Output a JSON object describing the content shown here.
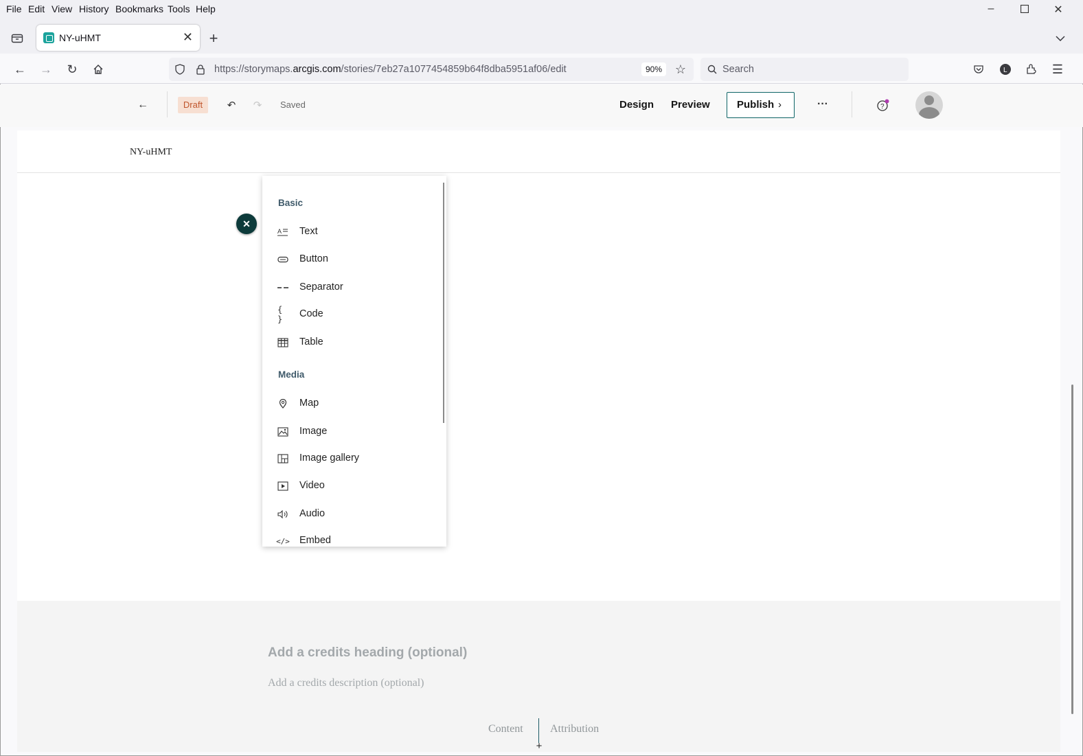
{
  "browser": {
    "menu": [
      "File",
      "Edit",
      "View",
      "History",
      "Bookmarks",
      "Tools",
      "Help"
    ],
    "tab_title": "NY-uHMT",
    "url_prefix": "https://storymaps.",
    "url_domain": "arcgis.com",
    "url_path": "/stories/7eb27a1077454859b64f8dba5951af06/edit",
    "zoom": "90%",
    "search_placeholder": "Search"
  },
  "app_header": {
    "status": "Draft",
    "saved": "Saved",
    "design": "Design",
    "preview": "Preview",
    "publish": "Publish"
  },
  "story": {
    "title": "NY-uHMT"
  },
  "insert_menu": {
    "sections": [
      {
        "label": "Basic",
        "items": [
          {
            "label": "Text",
            "icon": "text-icon"
          },
          {
            "label": "Button",
            "icon": "button-icon"
          },
          {
            "label": "Separator",
            "icon": "separator-icon"
          },
          {
            "label": "Code",
            "icon": "code-icon"
          },
          {
            "label": "Table",
            "icon": "table-icon"
          }
        ]
      },
      {
        "label": "Media",
        "items": [
          {
            "label": "Map",
            "icon": "map-icon"
          },
          {
            "label": "Image",
            "icon": "image-icon"
          },
          {
            "label": "Image gallery",
            "icon": "image-gallery-icon"
          },
          {
            "label": "Video",
            "icon": "video-icon"
          },
          {
            "label": "Audio",
            "icon": "audio-icon"
          },
          {
            "label": "Embed",
            "icon": "embed-icon"
          }
        ]
      }
    ]
  },
  "credits": {
    "heading_placeholder": "Add a credits heading (optional)",
    "description_placeholder": "Add a credits description (optional)",
    "tabs": [
      "Content",
      "Attribution"
    ]
  },
  "colors": {
    "accent": "#0d6466",
    "draft_bg": "#f7dfd2",
    "draft_text": "#c0552c",
    "close_fab": "#0d3b3b"
  }
}
